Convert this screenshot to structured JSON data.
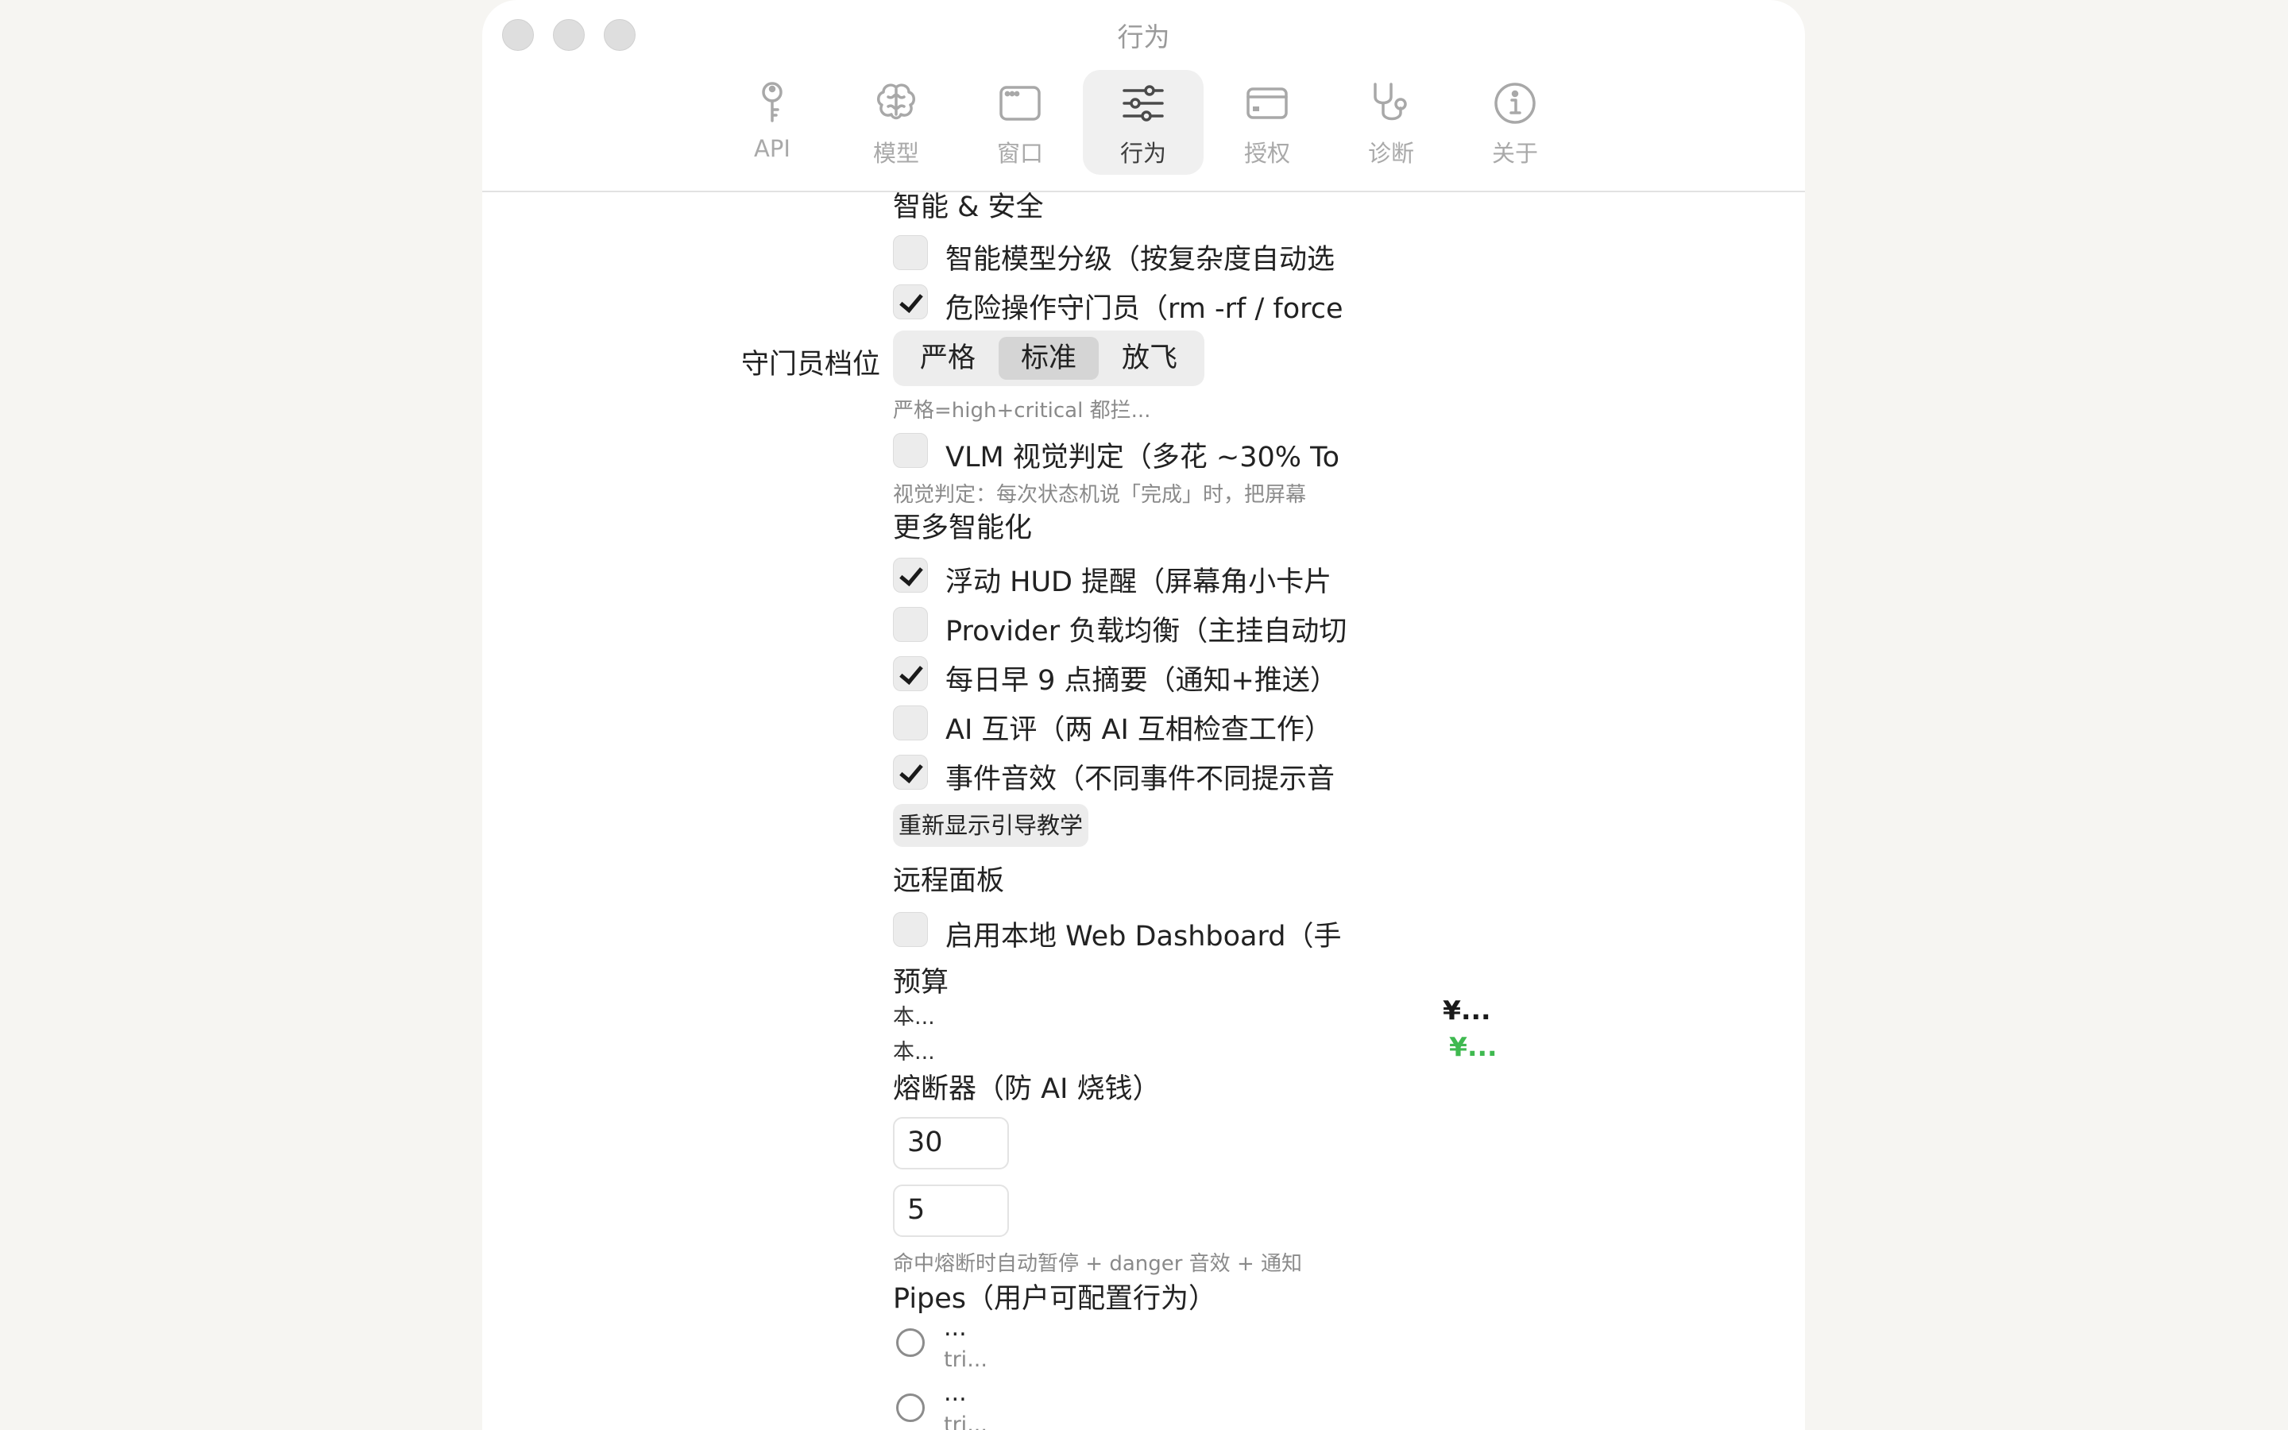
{
  "window": {
    "title": "行为"
  },
  "toolbar": {
    "tabs": [
      {
        "label": "API",
        "icon": "key-icon"
      },
      {
        "label": "模型",
        "icon": "brain-icon"
      },
      {
        "label": "窗口",
        "icon": "window-icon"
      },
      {
        "label": "行为",
        "icon": "sliders-icon",
        "active": true
      },
      {
        "label": "授权",
        "icon": "credit-card-icon"
      },
      {
        "label": "诊断",
        "icon": "stethoscope-icon"
      },
      {
        "label": "关于",
        "icon": "info-icon"
      }
    ]
  },
  "sections": {
    "smart_safety": {
      "heading": "智能 & 安全",
      "tiered_models": {
        "label": "智能模型分级（按复杂度自动选",
        "checked": false
      },
      "danger_guard": {
        "label": "危险操作守门员（rm -rf / force",
        "checked": true
      },
      "guard_level": {
        "label": "守门员档位",
        "options": [
          "严格",
          "标准",
          "放飞"
        ],
        "selected": "标准",
        "note": "严格=high+critical 都拦..."
      },
      "vlm_judge": {
        "label": "VLM 视觉判定（多花 ~30% To",
        "checked": false,
        "note": "视觉判定：每次状态机说「完成」时，把屏幕"
      }
    },
    "more_smart": {
      "heading": "更多智能化",
      "items": [
        {
          "label": "浮动 HUD 提醒（屏幕角小卡片",
          "checked": true
        },
        {
          "label": "Provider 负载均衡（主挂自动切",
          "checked": false
        },
        {
          "label": "每日早 9 点摘要（通知+推送）",
          "checked": true
        },
        {
          "label": "AI 互评（两 AI 互相检查工作）",
          "checked": false
        },
        {
          "label": "事件音效（不同事件不同提示音",
          "checked": true
        }
      ],
      "reshow_button": "重新显示引导教学"
    },
    "remote": {
      "heading": "远程面板",
      "web_dashboard": {
        "label": "启用本地 Web Dashboard（手",
        "checked": false
      }
    },
    "budget": {
      "heading": "预算",
      "rows": [
        {
          "label": "本...",
          "value": "¥...",
          "color": "#1a1a1a"
        },
        {
          "label": "本...",
          "value": "¥...",
          "color": "#3fb950"
        }
      ]
    },
    "breaker": {
      "heading": "熔断器（防 AI 烧钱）",
      "field1": "30",
      "field2": "5",
      "note": "命中熔断时自动暂停 + danger 音效 + 通知"
    },
    "pipes": {
      "heading": "Pipes（用户可配置行为）",
      "items": [
        {
          "name": "...",
          "sub": "tri..."
        },
        {
          "name": "...",
          "sub": "tri..."
        }
      ]
    }
  }
}
